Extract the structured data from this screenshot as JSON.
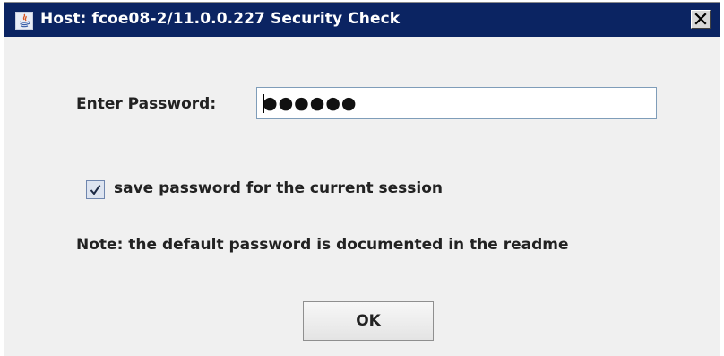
{
  "window": {
    "title": "Host:  fcoe08-2/11.0.0.227 Security Check",
    "app_icon": "java-icon",
    "close_icon": "close-icon",
    "titlebar_color": "#0b2462"
  },
  "form": {
    "password_label": "Enter Password:",
    "password_value": "●●●●●●",
    "save_password": {
      "checked": true,
      "label": "save password for the current session"
    },
    "note": "Note:  the default password is documented in the readme"
  },
  "buttons": {
    "ok_label": "OK"
  }
}
